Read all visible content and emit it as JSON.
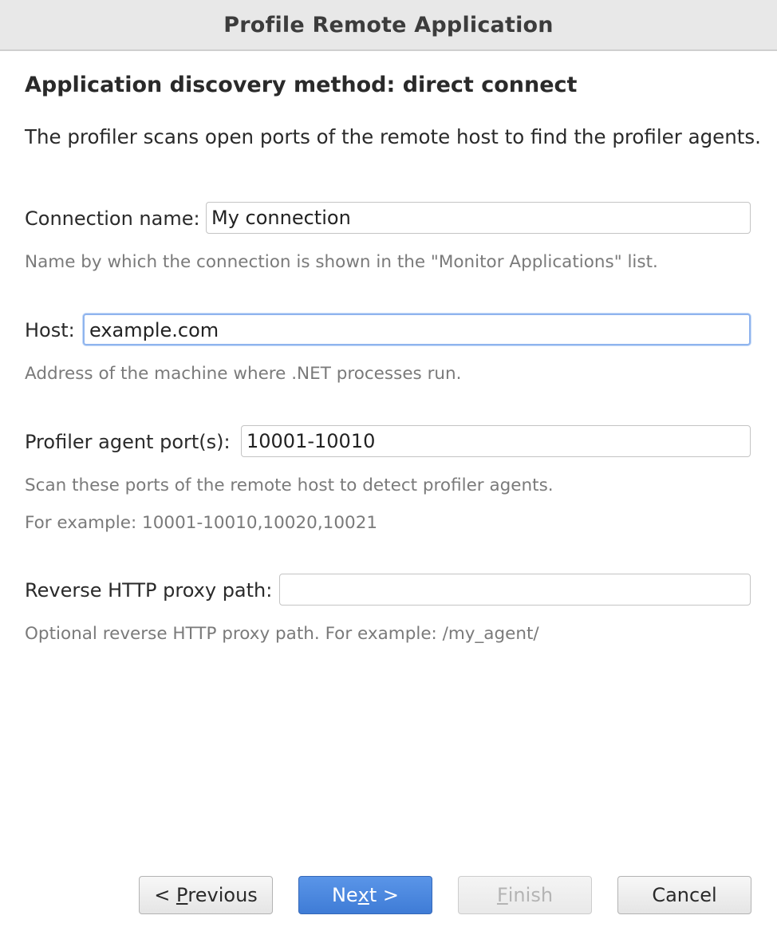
{
  "window": {
    "title": "Profile Remote Application"
  },
  "page": {
    "heading": "Application discovery method: direct connect",
    "description": "The profiler scans open ports of the remote host to find the profiler agents."
  },
  "form": {
    "connection_name": {
      "label": "Connection name:",
      "value": "My connection",
      "hint": "Name by which the connection is shown in the \"Monitor Applications\" list."
    },
    "host": {
      "label": "Host:",
      "value": "example.com",
      "hint": "Address of the machine where .NET processes run."
    },
    "agent_ports": {
      "label": "Profiler agent port(s):",
      "value": "10001-10010",
      "hint": "Scan these ports of the remote host to detect profiler agents.",
      "example": "For example: 10001-10010,10020,10021"
    },
    "proxy_path": {
      "label": "Reverse HTTP proxy path:",
      "value": "",
      "hint": "Optional reverse HTTP proxy path. For example: /my_agent/"
    }
  },
  "buttons": {
    "previous": {
      "prefix": "< ",
      "mnemonic": "P",
      "rest": "revious"
    },
    "next": {
      "prefix": "Ne",
      "mnemonic": "x",
      "rest": "t >"
    },
    "finish": {
      "mnemonic": "F",
      "rest": "inish"
    },
    "cancel": {
      "label": "Cancel"
    }
  },
  "colors": {
    "primary_button": "#4a88e0",
    "focus_ring": "#8fb4ee",
    "hint_text": "#7a7a7a",
    "titlebar_bg": "#e8e8e8"
  }
}
